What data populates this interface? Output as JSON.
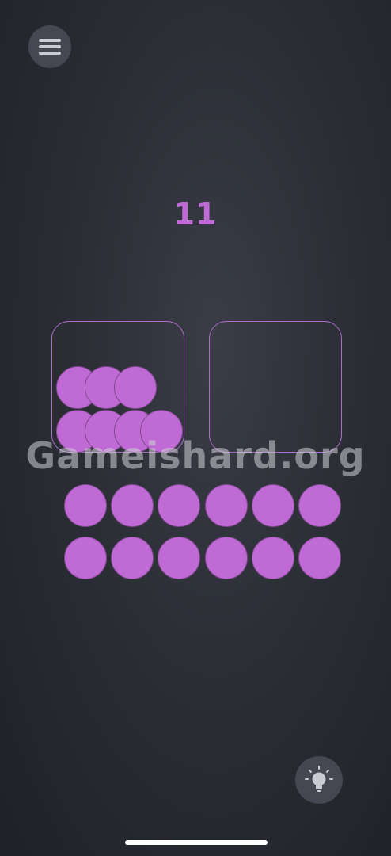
{
  "header": {
    "menu_icon": "hamburger-menu-icon"
  },
  "game": {
    "score": "11",
    "ball_color": "#c06ad6",
    "border_color": "#b06bd0",
    "boxes": [
      {
        "id": "left",
        "ball_count": 7
      },
      {
        "id": "right",
        "ball_count": 0
      }
    ],
    "tray_rows": 2,
    "tray_columns": 6
  },
  "watermark": "Gameishard.org",
  "footer": {
    "hint_icon": "lightbulb-icon"
  }
}
